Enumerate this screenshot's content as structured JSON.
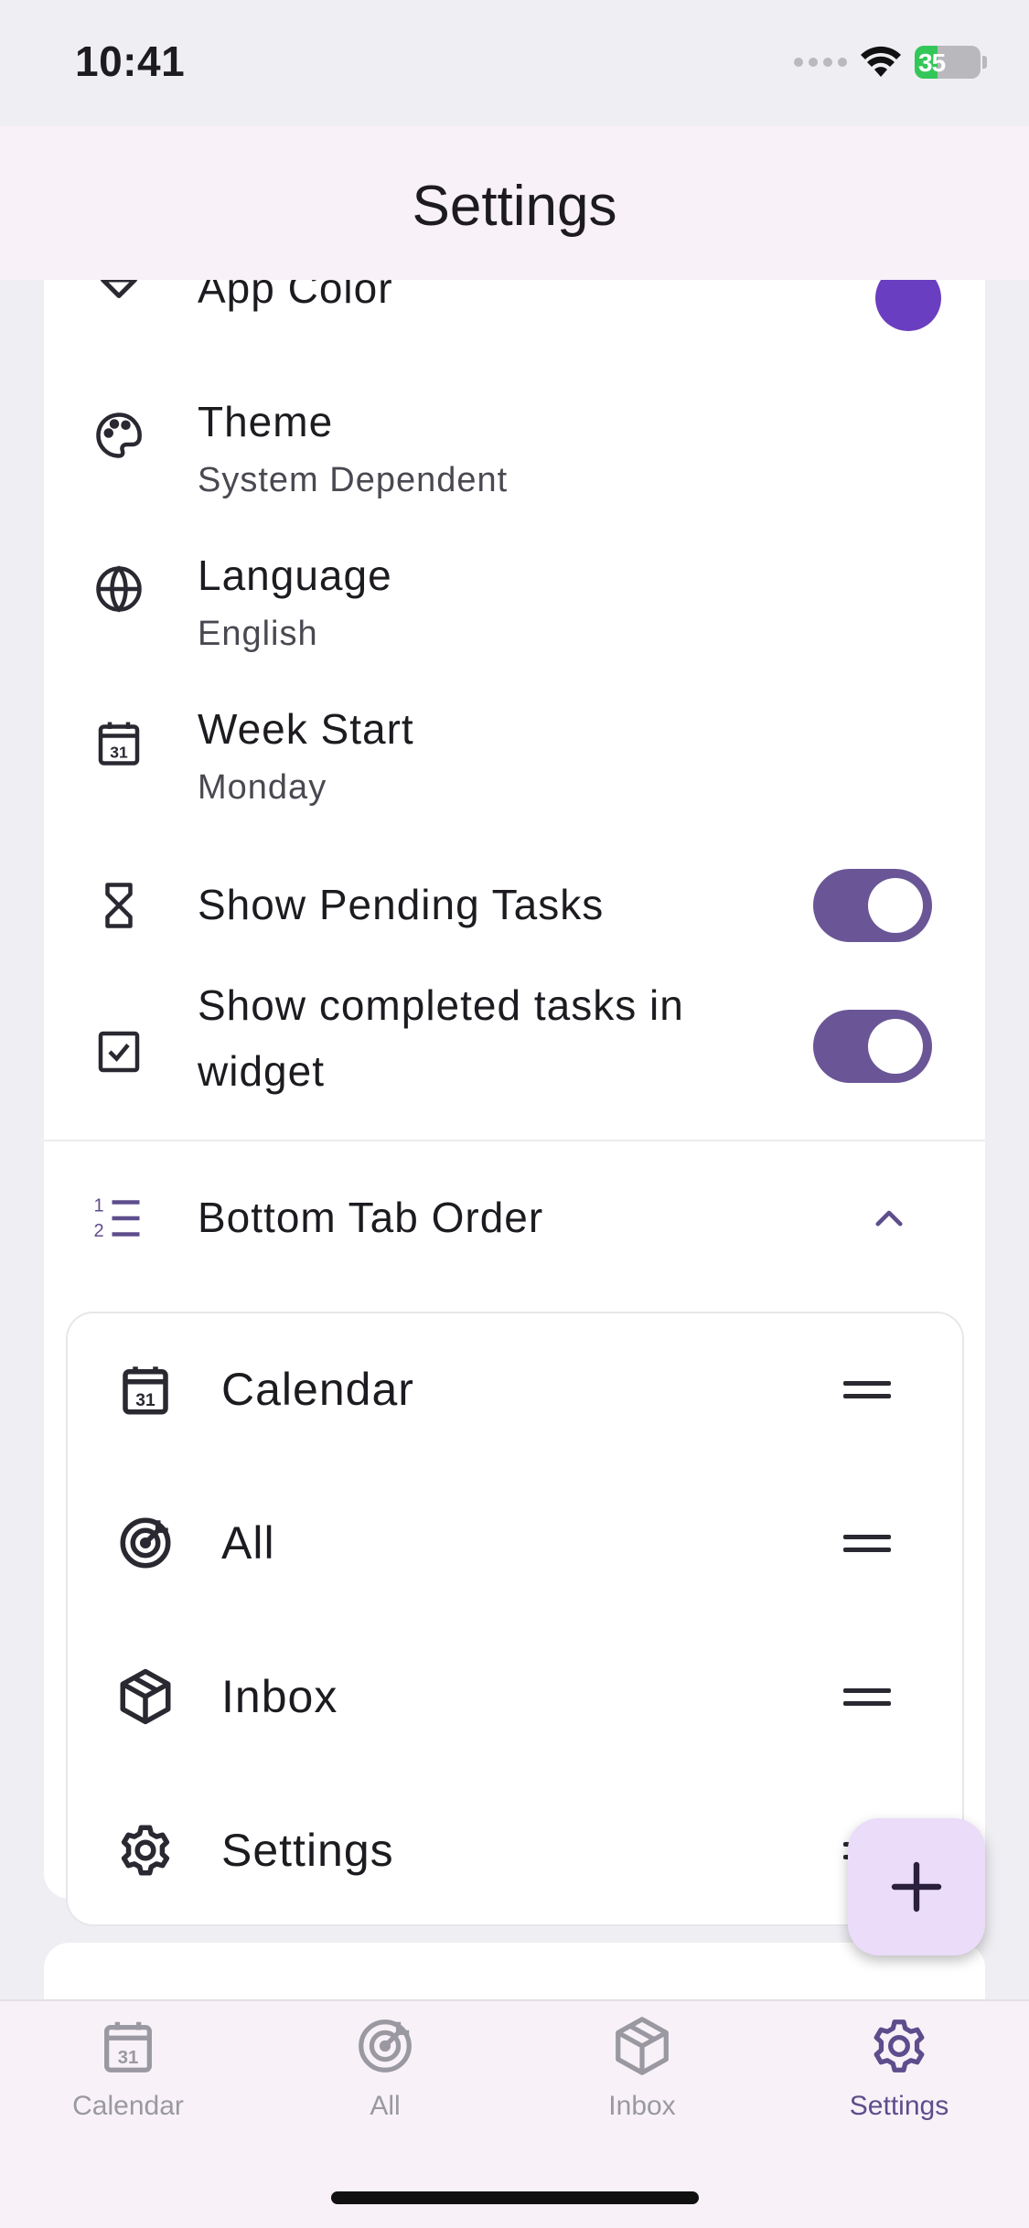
{
  "status_bar": {
    "time": "10:41",
    "battery": "35"
  },
  "header": {
    "title": "Settings"
  },
  "settings": {
    "app_color": {
      "label": "App Color",
      "color": "#6a3ec0"
    },
    "theme": {
      "label": "Theme",
      "value": "System Dependent"
    },
    "language": {
      "label": "Language",
      "value": "English"
    },
    "week_start": {
      "label": "Week Start",
      "value": "Monday"
    },
    "show_pending": {
      "label": "Show Pending Tasks",
      "enabled": true
    },
    "show_completed_widget": {
      "label_line1": "Show completed tasks in",
      "label_line2": "widget",
      "enabled": true
    },
    "bottom_tab_order": {
      "label": "Bottom Tab Order",
      "items": [
        {
          "label": "Calendar",
          "icon": "calendar-icon"
        },
        {
          "label": "All",
          "icon": "target-icon"
        },
        {
          "label": "Inbox",
          "icon": "box-icon"
        },
        {
          "label": "Settings",
          "icon": "gear-icon"
        }
      ]
    }
  },
  "tab_bar": {
    "items": [
      {
        "label": "Calendar",
        "icon": "calendar-icon",
        "active": false
      },
      {
        "label": "All",
        "icon": "target-icon",
        "active": false
      },
      {
        "label": "Inbox",
        "icon": "box-icon",
        "active": false
      },
      {
        "label": "Settings",
        "icon": "gear-icon",
        "active": true
      }
    ]
  },
  "colors": {
    "accent": "#6a5596",
    "tab_active": "#5e4d8c",
    "fab_bg": "#ebdcfa"
  }
}
